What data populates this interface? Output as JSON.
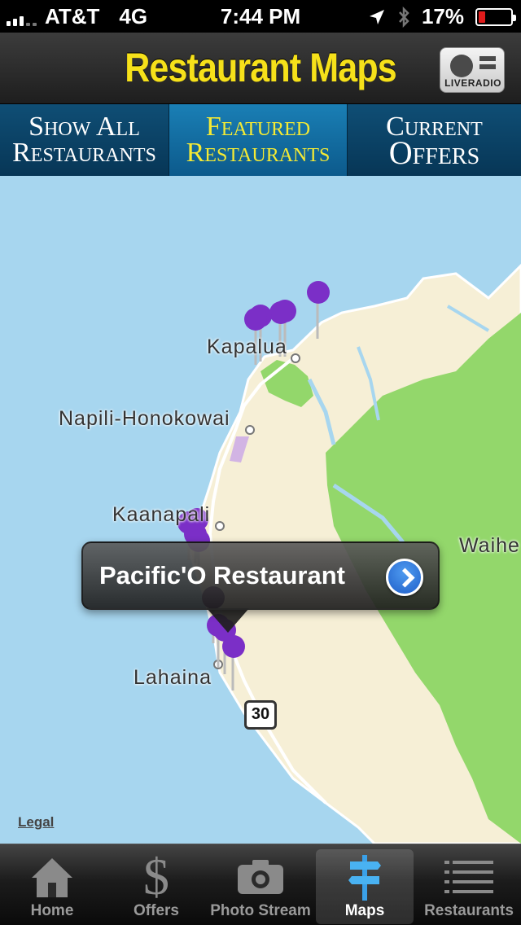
{
  "status_bar": {
    "carrier": "AT&T",
    "network": "4G",
    "time": "7:44 PM",
    "battery": "17%",
    "battery_color": "#e01b1b"
  },
  "header": {
    "title": "Restaurant Maps",
    "radio_label": "LIVERADIO",
    "title_color": "#f6e11a"
  },
  "segments": [
    {
      "line1": "Show All",
      "line2": "Restaurants",
      "active": false
    },
    {
      "line1": "Featured",
      "line2": "Restaurants",
      "active": true
    },
    {
      "line1": "Current",
      "line2": "Offers",
      "active": false
    }
  ],
  "map": {
    "places": [
      "Kapalua",
      "Napili-Honokowai",
      "Kaanapali",
      "Lahaina",
      "Waihe"
    ],
    "route_shield": "30",
    "legal": "Legal",
    "callout": {
      "title": "Pacific'O Restaurant",
      "icon": "detail-disclosure-icon"
    },
    "pin_color": "#7b2fc7"
  },
  "tabbar": [
    {
      "label": "Home",
      "icon": "home-icon",
      "active": false
    },
    {
      "label": "Offers",
      "icon": "dollar-icon",
      "active": false
    },
    {
      "label": "Photo Stream",
      "icon": "camera-icon",
      "active": false
    },
    {
      "label": "Maps",
      "icon": "signpost-icon",
      "active": true
    },
    {
      "label": "Restaurants",
      "icon": "list-icon",
      "active": false
    }
  ]
}
